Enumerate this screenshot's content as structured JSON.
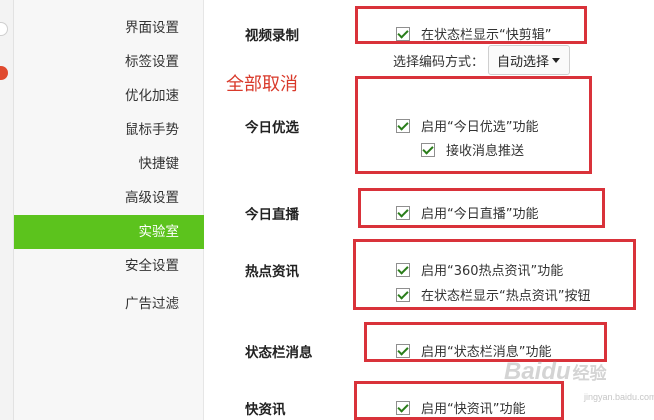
{
  "sidebar": {
    "items": [
      {
        "label": "界面设置",
        "active": false
      },
      {
        "label": "标签设置",
        "active": false
      },
      {
        "label": "优化加速",
        "active": false
      },
      {
        "label": "鼠标手势",
        "active": false
      },
      {
        "label": "快捷键",
        "active": false
      },
      {
        "label": "高级设置",
        "active": false
      },
      {
        "label": "实验室",
        "active": true
      },
      {
        "label": "安全设置",
        "active": false
      },
      {
        "label": "广告过滤",
        "active": false
      }
    ],
    "active_color": "#5cc31d"
  },
  "annotation": {
    "cancel_all": "全部取消",
    "highlight_color": "#d9323a"
  },
  "sections": {
    "video_record": {
      "title": "视频录制",
      "options": [
        {
          "label": "在状态栏显示“快剪辑”",
          "checked": true
        }
      ],
      "encode_label": "选择编码方式：",
      "encode_value": "自动选择"
    },
    "today_pick": {
      "title": "今日优选",
      "options": [
        {
          "label": "启用“今日优选”功能",
          "checked": true
        },
        {
          "label": "接收消息推送",
          "checked": true
        }
      ]
    },
    "today_live": {
      "title": "今日直播",
      "options": [
        {
          "label": "启用“今日直播”功能",
          "checked": true
        }
      ]
    },
    "hot_news": {
      "title": "热点资讯",
      "options": [
        {
          "label": "启用“360热点资讯”功能",
          "checked": true
        },
        {
          "label": "在状态栏显示“热点资讯”按钮",
          "checked": true
        }
      ]
    },
    "status_msg": {
      "title": "状态栏消息",
      "options": [
        {
          "label": "启用“状态栏消息”功能",
          "checked": true
        }
      ]
    },
    "quick_news": {
      "title": "快资讯",
      "options": [
        {
          "label": "启用“快资讯”功能",
          "checked": true
        }
      ]
    }
  },
  "watermark": {
    "brand": "Baidu",
    "sub": "经验",
    "url": "jingyan.baidu.com"
  }
}
